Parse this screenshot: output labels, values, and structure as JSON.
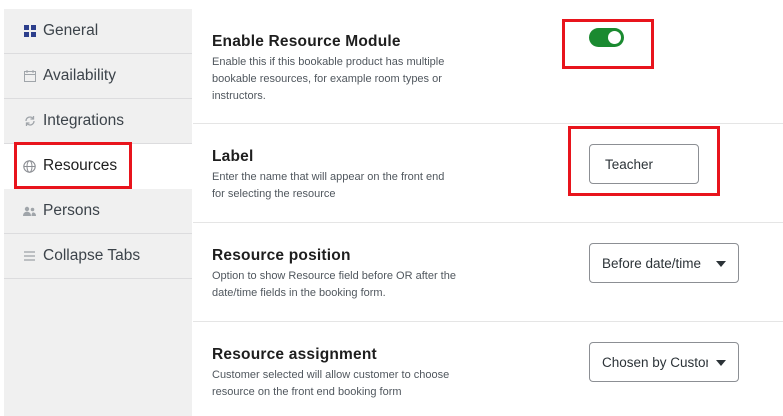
{
  "sidebar": {
    "tabs": [
      {
        "label": "General",
        "icon": "grid-icon",
        "active": false
      },
      {
        "label": "Availability",
        "icon": "calendar-icon",
        "active": false
      },
      {
        "label": "Integrations",
        "icon": "sync-icon",
        "active": false
      },
      {
        "label": "Resources",
        "icon": "globe-icon",
        "active": true
      },
      {
        "label": "Persons",
        "icon": "people-icon",
        "active": false
      },
      {
        "label": "Collapse Tabs",
        "icon": "menu-icon",
        "active": false
      }
    ]
  },
  "settings": {
    "enable_module": {
      "title": "Enable Resource Module",
      "description": "Enable this if this bookable product has multiple bookable resources, for example room types or instructors.",
      "enabled": true
    },
    "label": {
      "title": "Label",
      "description": "Enter the name that will appear on the front end for selecting the resource",
      "value": "Teacher"
    },
    "position": {
      "title": "Resource position",
      "description": "Option to show Resource field before OR after the date/time fields in the booking form.",
      "selected": "Before date/time"
    },
    "assignment": {
      "title": "Resource assignment",
      "description": "Customer selected will allow customer to choose resource on the front end booking form",
      "selected": "Chosen by Customer"
    }
  },
  "colors": {
    "toggle_on": "#1a8a30",
    "annotation": "#e8141c",
    "sidebar_bg": "#f0f0f0"
  }
}
